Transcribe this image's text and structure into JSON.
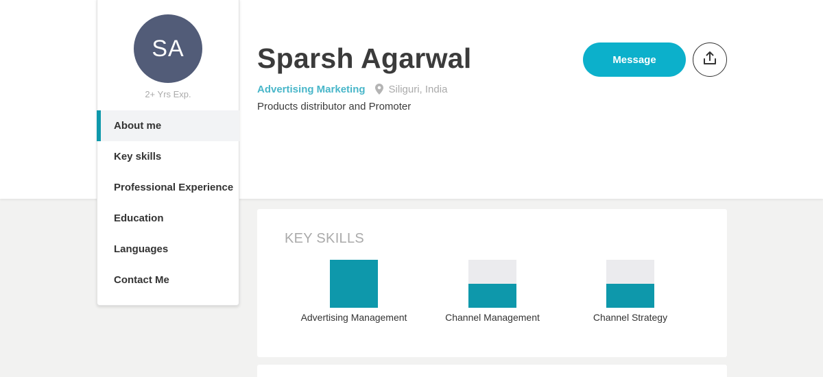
{
  "colors": {
    "accent": "#0e98ab",
    "avatar_bg": "#525c78",
    "button_bg": "#0cb0cb",
    "role_text": "#48b6c9"
  },
  "profile": {
    "initials": "SA",
    "experience": "2+ Yrs Exp.",
    "name": "Sparsh Agarwal",
    "role": "Advertising Marketing",
    "location": "Siliguri, India",
    "tagline": "Products distributor and Promoter",
    "location_icon": "map-pin-icon"
  },
  "actions": {
    "message_label": "Message",
    "share_icon": "share-upload-icon"
  },
  "nav": {
    "items": [
      {
        "label": "About me",
        "active": true
      },
      {
        "label": "Key skills",
        "active": false
      },
      {
        "label": "Professional Experience",
        "active": false
      },
      {
        "label": "Education",
        "active": false
      },
      {
        "label": "Languages",
        "active": false
      },
      {
        "label": "Contact Me",
        "active": false
      }
    ]
  },
  "key_skills": {
    "title": "KEY SKILLS",
    "skills": [
      {
        "label": "Advertising Management",
        "level": 1.0
      },
      {
        "label": "Channel Management",
        "level": 0.5
      },
      {
        "label": "Channel Strategy",
        "level": 0.5
      }
    ]
  }
}
